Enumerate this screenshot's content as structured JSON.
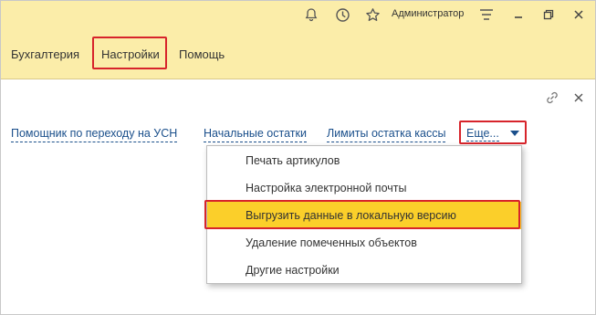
{
  "titlebar": {
    "user": "Администратор",
    "icons": [
      "bell-icon",
      "history-icon",
      "star-icon",
      "menu-icon",
      "minimize-icon",
      "restore-icon",
      "close-icon"
    ]
  },
  "menubar": {
    "items": [
      {
        "label": "Бухгалтерия"
      },
      {
        "label": "Настройки",
        "highlighted": true
      },
      {
        "label": "Помощь"
      }
    ]
  },
  "commandbar": {
    "links": [
      {
        "label": "Помощник по переходу на УСН"
      },
      {
        "label": "Начальные остатки"
      },
      {
        "label": "Лимиты остатка кассы"
      }
    ],
    "more_label": "Еще..."
  },
  "dropdown": {
    "items": [
      {
        "label": "Печать артикулов"
      },
      {
        "label": "Настройка электронной почты"
      },
      {
        "label": "Выгрузить данные в локальную версию",
        "selected": true
      },
      {
        "label": "Удаление помеченных объектов"
      },
      {
        "label": "Другие настройки"
      }
    ]
  },
  "colors": {
    "titlebar_bg": "#fbeda9",
    "highlight_border": "#d7242b",
    "selected_bg": "#fbcf2a",
    "link": "#1a4f8b"
  }
}
